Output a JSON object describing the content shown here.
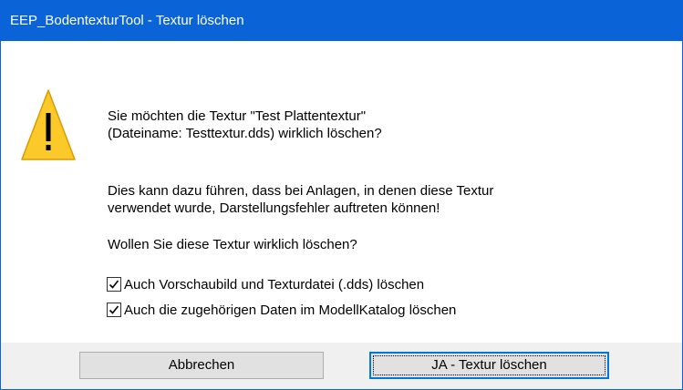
{
  "window": {
    "title": "EEP_BodentexturTool - Textur löschen"
  },
  "icon": "warning-icon",
  "message": {
    "line1": "Sie möchten die Textur \"Test Plattentextur\"",
    "line2": "(Dateiname: Testtextur.dds) wirklich löschen?",
    "line3": "Dies kann dazu führen, dass bei Anlagen, in denen diese Textur",
    "line4": "verwendet wurde, Darstellungsfehler auftreten können!",
    "question": "Wollen Sie diese Textur wirklich löschen?"
  },
  "checkboxes": [
    {
      "label": "Auch Vorschaubild und Texturdatei (.dds) löschen",
      "checked": true
    },
    {
      "label": "Auch die zugehörigen Daten im ModellKatalog löschen",
      "checked": true
    }
  ],
  "buttons": {
    "cancel": "Abbrechen",
    "confirm": "JA - Textur löschen"
  },
  "colors": {
    "titlebar": "#0a64d8",
    "warning": "#fcc92a",
    "focus_border": "#0078d7"
  }
}
